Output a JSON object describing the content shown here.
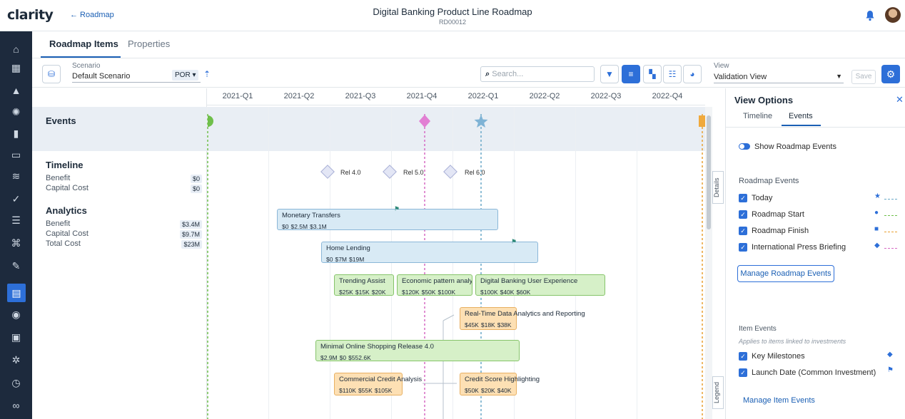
{
  "app": {
    "logo": "clarity",
    "back_label": "← Roadmap",
    "title": "Digital Banking Product Line Roadmap",
    "code": "RD00012"
  },
  "tabs": [
    {
      "label": "Roadmap Items"
    },
    {
      "label": "Properties"
    }
  ],
  "toolbar": {
    "scenario_label": "Scenario",
    "scenario_value": "Default Scenario",
    "por": "POR ▾",
    "search_placeholder": "Search...",
    "view_label": "View",
    "view_value": "Validation View",
    "save_label": "Save"
  },
  "quarters": [
    "2021-Q1",
    "2021-Q2",
    "2021-Q3",
    "2021-Q4",
    "2022-Q1",
    "2022-Q2",
    "2022-Q3",
    "2022-Q4"
  ],
  "left": {
    "events_title": "Events",
    "timeline": {
      "title": "Timeline",
      "rows": [
        {
          "label": "Benefit",
          "value": "$0"
        },
        {
          "label": "Capital Cost",
          "value": "$0"
        }
      ]
    },
    "analytics": {
      "title": "Analytics",
      "rows": [
        {
          "label": "Benefit",
          "value": "$3.4M"
        },
        {
          "label": "Capital Cost",
          "value": "$9.7M"
        },
        {
          "label": "Total Cost",
          "value": "$23M"
        }
      ]
    }
  },
  "milestones": [
    "Rel 4.0",
    "Rel 5.0",
    "Rel 6.0"
  ],
  "bars": [
    {
      "name": "Monetary Transfers",
      "color": "blue",
      "values": [
        "$0",
        "$2.5M",
        "$3.1M"
      ]
    },
    {
      "name": "Home Lending",
      "color": "blue",
      "values": [
        "$0",
        "$7M",
        "$19M"
      ]
    },
    {
      "name": "Trending Assist",
      "color": "green",
      "values": [
        "$25K",
        "$15K",
        "$20K"
      ]
    },
    {
      "name": "Economic pattern analyti",
      "color": "green",
      "values": [
        "$120K",
        "$50K",
        "$100K"
      ]
    },
    {
      "name": "Digital Banking User Experience",
      "color": "green",
      "values": [
        "$100K",
        "$40K",
        "$60K"
      ]
    },
    {
      "name": "Real-Time Data Analytics and Reporting",
      "color": "orange",
      "values": [
        "$45K",
        "$18K",
        "$38K"
      ]
    },
    {
      "name": "Minimal Online Shopping Release 4.0",
      "color": "green",
      "values": [
        "$2.9M",
        "$0",
        "$552.6K"
      ]
    },
    {
      "name": "Commercial Credit Analysis",
      "color": "orange",
      "values": [
        "$110K",
        "$55K",
        "$105K"
      ]
    },
    {
      "name": "Credit Score Highlighting",
      "color": "orange",
      "values": [
        "$50K",
        "$20K",
        "$40K"
      ]
    }
  ],
  "side_tabs": {
    "details": "Details",
    "legend": "Legend"
  },
  "view_options": {
    "title": "View Options",
    "tabs": [
      "Timeline",
      "Events"
    ],
    "show_events": "Show Roadmap Events",
    "roadmap_events_title": "Roadmap Events",
    "roadmap_events": [
      {
        "label": "Today",
        "color": "#2d6fd8",
        "symbol": "★",
        "line_color": "#6aa9c8"
      },
      {
        "label": "Roadmap Start",
        "color": "#2d6fd8",
        "symbol": "●",
        "line_color": "#6fbf4a"
      },
      {
        "label": "Roadmap Finish",
        "color": "#2d6fd8",
        "symbol": "■",
        "line_color": "#e8a032"
      },
      {
        "label": "International Press Briefing",
        "color": "#2d6fd8",
        "symbol": "◆",
        "line_color": "#d66ac4"
      }
    ],
    "manage_roadmap_events": "Manage Roadmap Events",
    "item_events_title": "Item Events",
    "item_events_hint": "Applies to items linked to investments",
    "item_events": [
      {
        "label": "Key Milestones",
        "symbol": "◆"
      },
      {
        "label": "Launch Date (Common Investment)",
        "symbol": "⚑"
      }
    ],
    "manage_item_events": "Manage Item Events"
  },
  "colors": {
    "accent": "#2d6fd8",
    "nav": "#1d2a3d",
    "start": "#6fbf4a",
    "finish": "#e8a032",
    "today": "#6aa9c8",
    "press": "#d66ac4"
  }
}
